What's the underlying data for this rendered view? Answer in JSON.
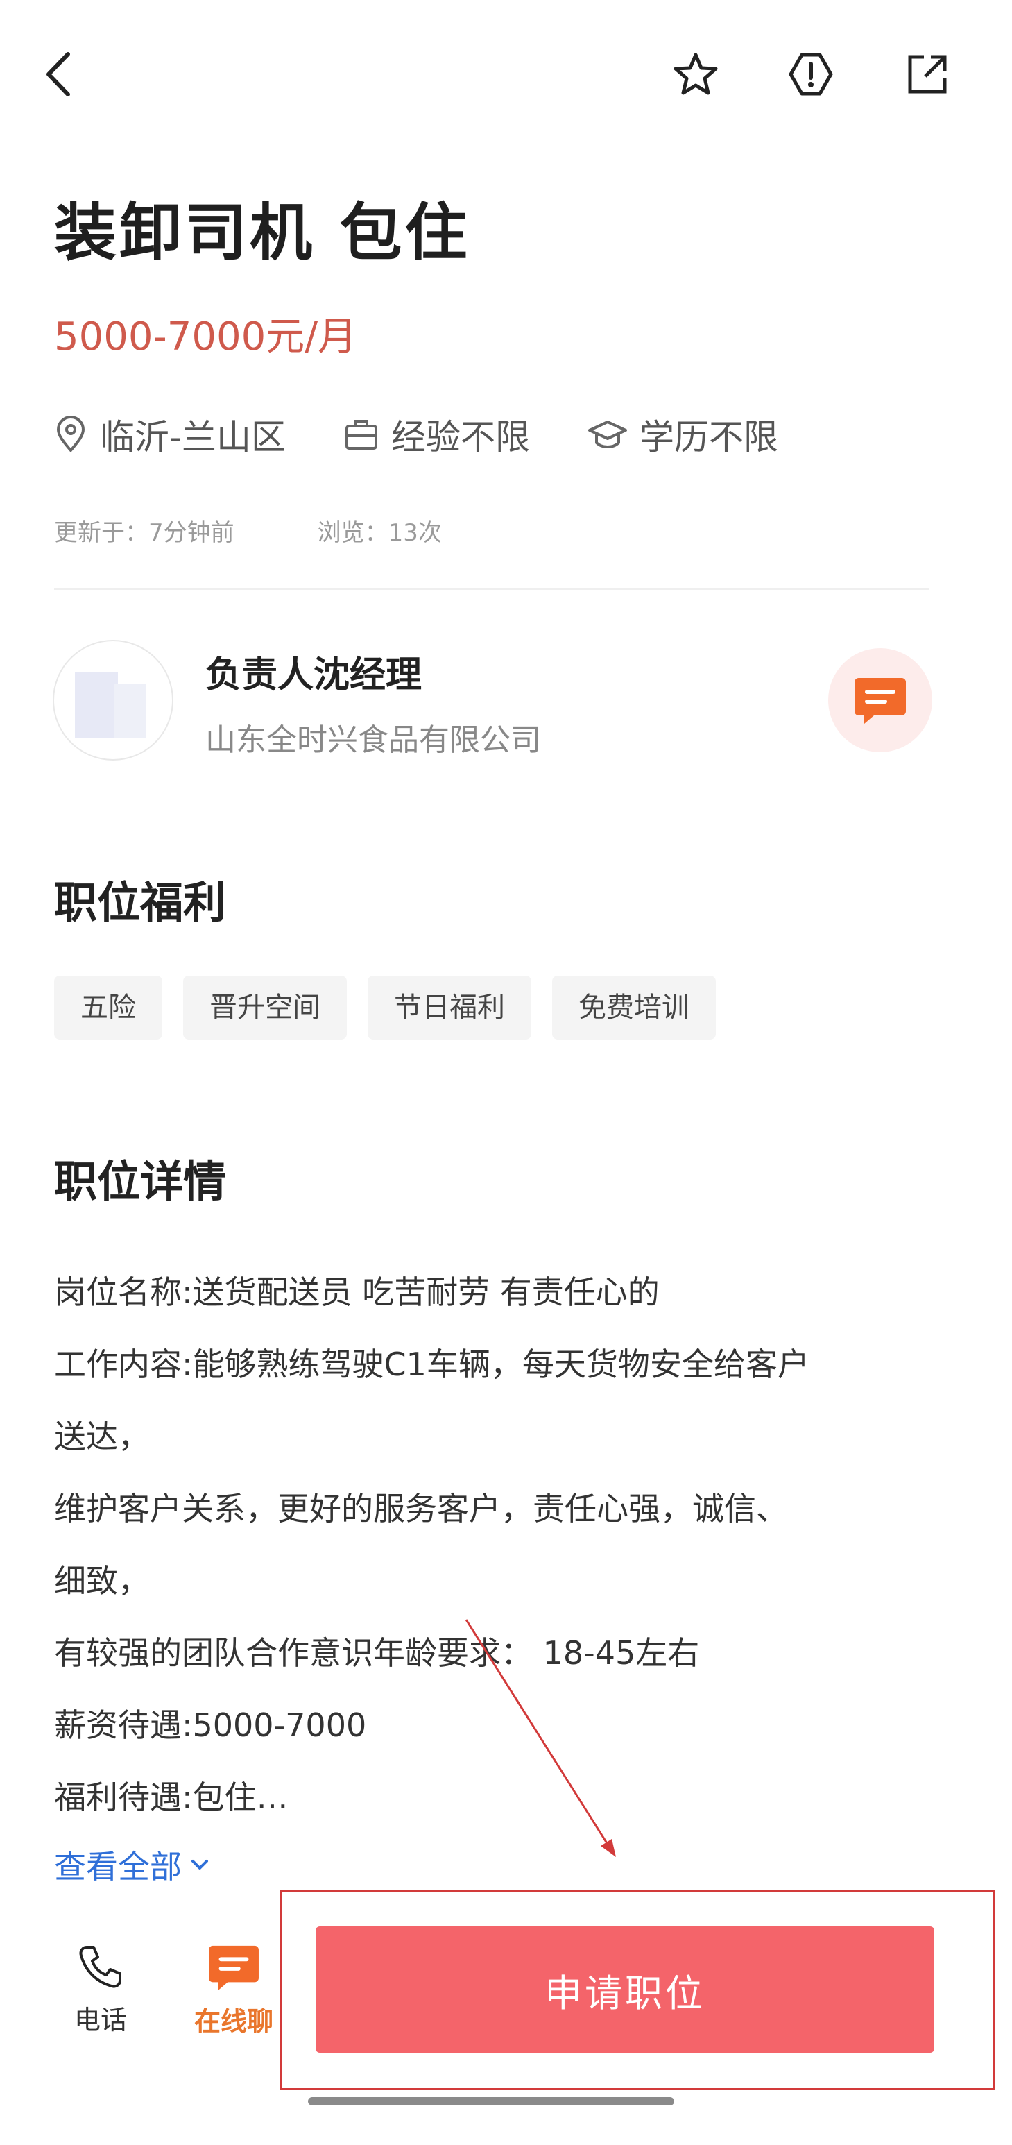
{
  "job": {
    "title": "装卸司机  包住",
    "salary": "5000-7000元/月",
    "location": "临沂-兰山区",
    "experience": "经验不限",
    "education": "学历不限",
    "updated": "更新于：7分钟前",
    "views": "浏览：13次"
  },
  "recruiter": {
    "name": "负责人沈经理",
    "company": "山东全时兴食品有限公司"
  },
  "benefits": {
    "title": "职位福利",
    "tags": [
      "五险",
      "晋升空间",
      "节日福利",
      "免费培训"
    ]
  },
  "details": {
    "title": "职位详情",
    "lines": [
      "岗位名称:送货配送员 吃苦耐劳 有责任心的",
      "工作内容:能够熟练驾驶C1车辆，每天货物安全给客户",
      "送达，",
      "维护客户关系，更好的服务客户，责任心强，诚信、",
      "细致，",
      "有较强的团队合作意识年龄要求： 18-45左右",
      "薪资待遇:5000-7000",
      "福利待遇:包住…"
    ],
    "more_label": "查看全部"
  },
  "bottom": {
    "phone_label": "电话",
    "chat_label": "在线聊",
    "apply_label": "申请职位"
  },
  "colors": {
    "salary": "#cf5a4c",
    "apply_button": "#f4646a",
    "chat_accent": "#e9762c",
    "link": "#2f6fd8",
    "annotation": "#d23a3a"
  },
  "icons": [
    "back-arrow-icon",
    "star-icon",
    "report-icon",
    "share-icon",
    "location-pin-icon",
    "briefcase-icon",
    "graduation-cap-icon",
    "chat-bubble-icon",
    "chevron-down-icon",
    "phone-icon"
  ]
}
